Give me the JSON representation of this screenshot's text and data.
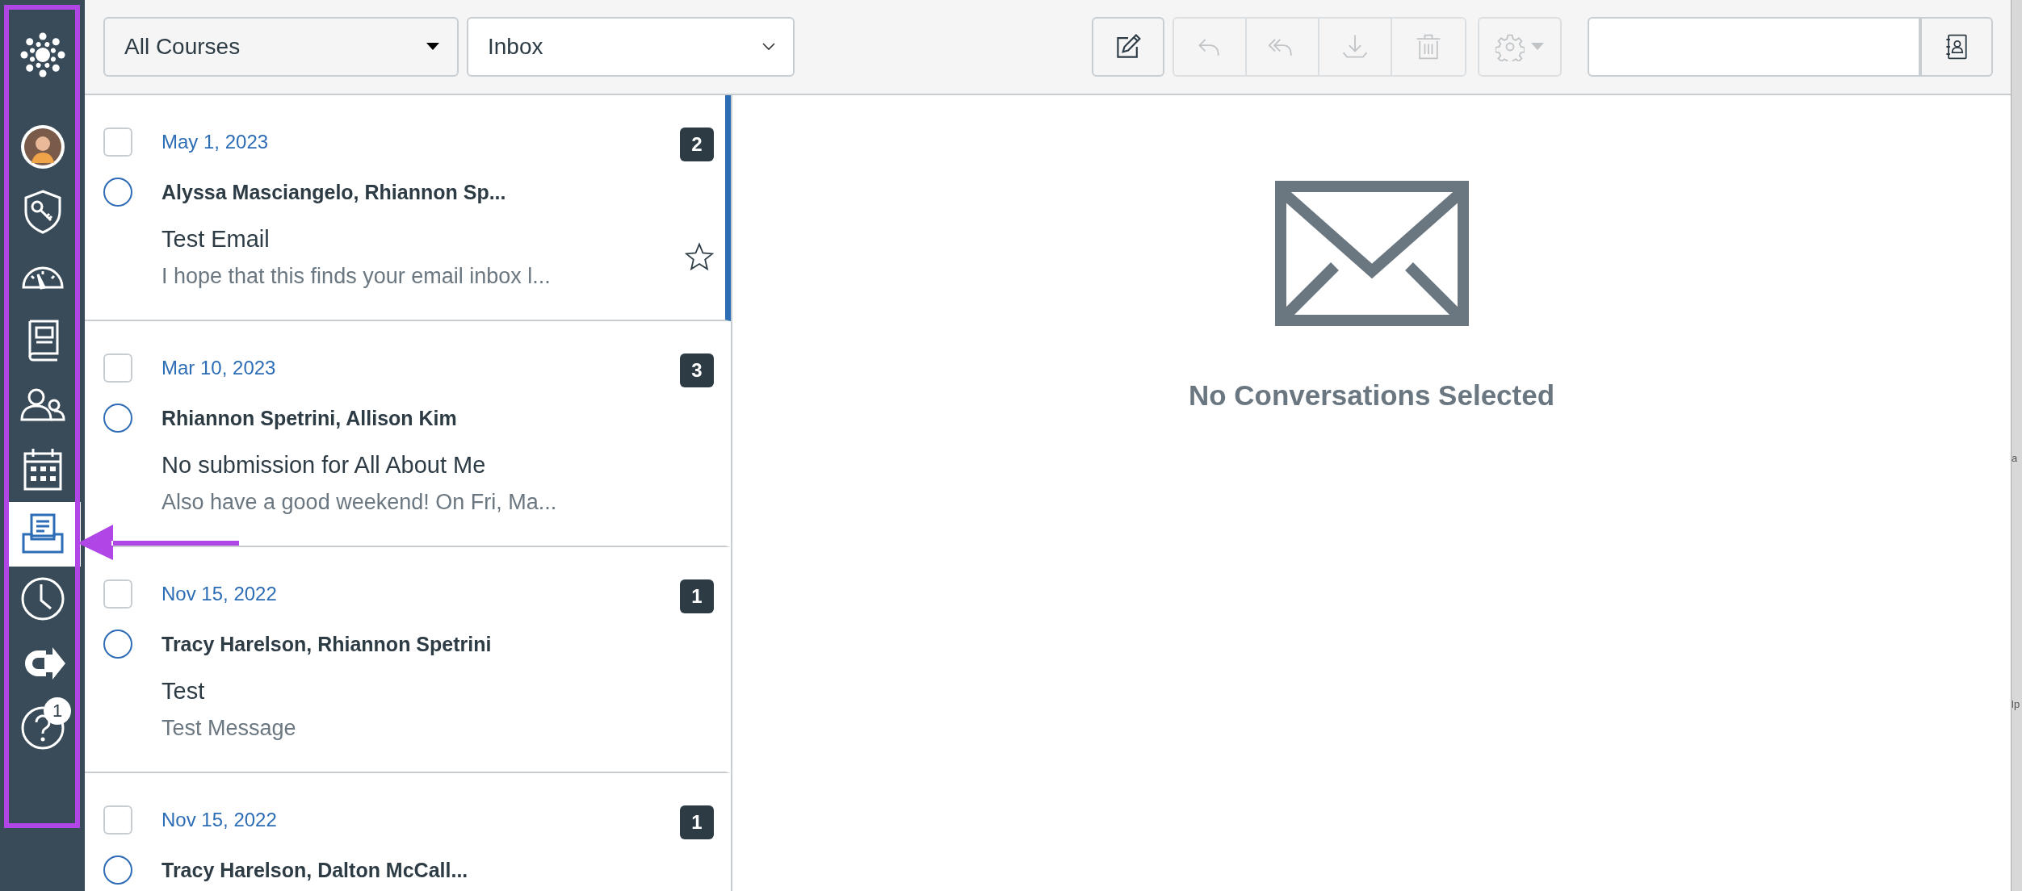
{
  "sidebar": {
    "items": [
      {
        "selected": false
      },
      {
        "selected": false
      },
      {
        "selected": false
      },
      {
        "selected": false
      },
      {
        "selected": false
      },
      {
        "selected": false
      },
      {
        "selected": false
      },
      {
        "selected": true
      },
      {
        "selected": false
      },
      {
        "selected": false
      },
      {
        "selected": false,
        "badge": "1"
      }
    ]
  },
  "toolbar": {
    "course_filter": "All Courses",
    "mailbox": "Inbox",
    "compose": {
      "disabled": false
    },
    "reply": {
      "disabled": true
    },
    "reply_all": {
      "disabled": true
    },
    "archive": {
      "disabled": true
    },
    "delete": {
      "disabled": true
    },
    "settings": {
      "disabled": true
    }
  },
  "messages": [
    {
      "date": "May 1, 2023",
      "count": "2",
      "sender": "Alyssa Masciangelo, Rhiannon Sp...",
      "subject": "Test Email",
      "preview": "I hope that this finds your email inbox l...",
      "selected": true,
      "unread": false,
      "starred": false
    },
    {
      "date": "Mar 10, 2023",
      "count": "3",
      "sender": "Rhiannon Spetrini, Allison Kim",
      "subject": "No submission for All About Me",
      "preview": "Also have a good weekend! On Fri, Ma...",
      "selected": false,
      "unread": false
    },
    {
      "date": "Nov 15, 2022",
      "count": "1",
      "sender": "Tracy Harelson, Rhiannon Spetrini",
      "subject": "Test",
      "preview": "Test Message",
      "selected": false,
      "unread": false
    },
    {
      "date": "Nov 15, 2022",
      "count": "1",
      "sender": "Tracy Harelson, Dalton McCall...",
      "selected": false,
      "unread": false
    }
  ],
  "detail": {
    "empty_message": "No Conversations Selected"
  },
  "edge": {
    "texts": [
      "a",
      "lp"
    ]
  }
}
